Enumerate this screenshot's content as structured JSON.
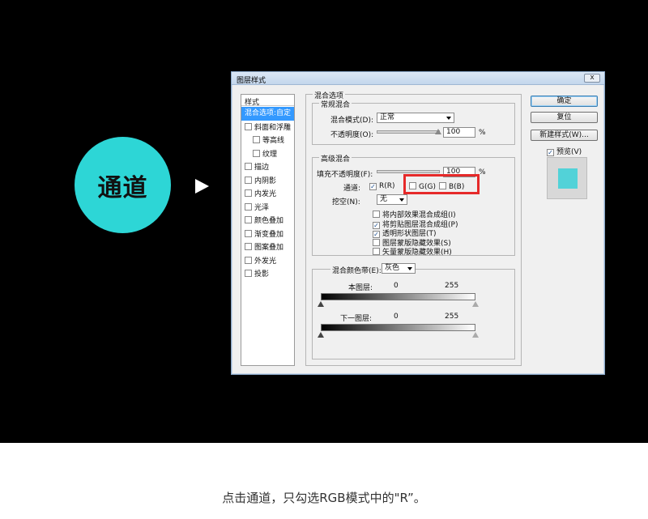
{
  "badge": {
    "text": "通道",
    "color": "#2dd6d6"
  },
  "dialog": {
    "title": "图层样式",
    "close_label": "x",
    "styles": {
      "header": "样式",
      "items": [
        {
          "label": "混合选项:自定",
          "selected": true,
          "checkbox": false,
          "indent": false
        },
        {
          "label": "斜面和浮雕",
          "checkbox": true,
          "indent": false
        },
        {
          "label": "等高线",
          "checkbox": true,
          "indent": true
        },
        {
          "label": "纹理",
          "checkbox": true,
          "indent": true
        },
        {
          "label": "描边",
          "checkbox": true,
          "indent": false
        },
        {
          "label": "内阴影",
          "checkbox": true,
          "indent": false
        },
        {
          "label": "内发光",
          "checkbox": true,
          "indent": false
        },
        {
          "label": "光泽",
          "checkbox": true,
          "indent": false
        },
        {
          "label": "颜色叠加",
          "checkbox": true,
          "indent": false
        },
        {
          "label": "渐变叠加",
          "checkbox": true,
          "indent": false
        },
        {
          "label": "图案叠加",
          "checkbox": true,
          "indent": false
        },
        {
          "label": "外发光",
          "checkbox": true,
          "indent": false
        },
        {
          "label": "投影",
          "checkbox": true,
          "indent": false
        }
      ]
    },
    "blend_options_label": "混合选项",
    "general": {
      "label": "常规混合",
      "mode_label": "混合模式(D):",
      "mode_value": "正常",
      "opacity_label": "不透明度(O):",
      "opacity_value": "100",
      "opacity_unit": "%"
    },
    "advanced": {
      "label": "高级混合",
      "fill_label": "填充不透明度(F):",
      "fill_value": "100",
      "fill_unit": "%",
      "channels_label": "通道:",
      "channel_r": "R(R)",
      "channel_g": "G(G)",
      "channel_b": "B(B)",
      "knockout_label": "挖空(N):",
      "knockout_value": "无",
      "options": [
        {
          "label": "将内部效果混合成组(I)",
          "checked": false
        },
        {
          "label": "将剪贴图层混合成组(P)",
          "checked": true
        },
        {
          "label": "透明形状图层(T)",
          "checked": true
        },
        {
          "label": "图层蒙版隐藏效果(S)",
          "checked": false
        },
        {
          "label": "矢量蒙版隐藏效果(H)",
          "checked": false
        }
      ]
    },
    "blend_if": {
      "label": "混合颜色带(E):",
      "value": "灰色",
      "this_layer_label": "本图层:",
      "this_layer_min": "0",
      "this_layer_max": "255",
      "underlying_label": "下一图层:",
      "underlying_min": "0",
      "underlying_max": "255"
    },
    "buttons": {
      "ok": "确定",
      "reset": "复位",
      "new_style": "新建样式(W)...",
      "preview": "预览(V)"
    },
    "preview_color": "#52d2d8",
    "highlight_color": "#e62a2a"
  },
  "caption": "点击通道，只勾选RGB模式中的\"R”。"
}
